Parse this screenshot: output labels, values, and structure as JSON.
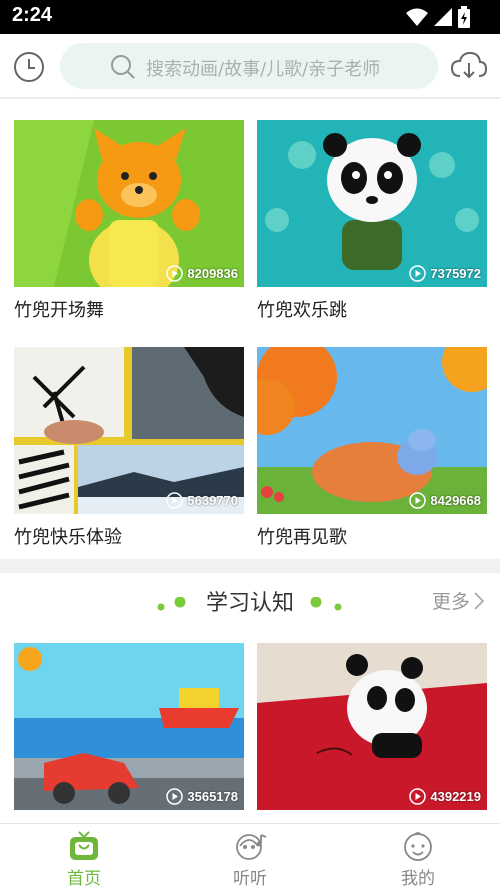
{
  "status_bar": {
    "time": "2:24"
  },
  "search": {
    "placeholder": "搜索动画/故事/儿歌/亲子老师"
  },
  "videos": [
    {
      "title": "竹兜开场舞",
      "plays": "8209836"
    },
    {
      "title": "竹兜欢乐跳",
      "plays": "7375972"
    },
    {
      "title": "竹兜快乐体验",
      "plays": "5639770"
    },
    {
      "title": "竹兜再见歌",
      "plays": "8429668"
    }
  ],
  "section_learning": {
    "title": "学习认知",
    "more": "更多",
    "videos": [
      {
        "plays": "3565178"
      },
      {
        "plays": "4392219"
      }
    ]
  },
  "tabs": [
    {
      "label": "首页",
      "icon": "tv-icon",
      "active": true
    },
    {
      "label": "听听",
      "icon": "headphone-icon",
      "active": false
    },
    {
      "label": "我的",
      "icon": "baby-face-icon",
      "active": false
    }
  ],
  "colors": {
    "accent": "#6fb73a",
    "search_bg": "#eaf5f1"
  }
}
